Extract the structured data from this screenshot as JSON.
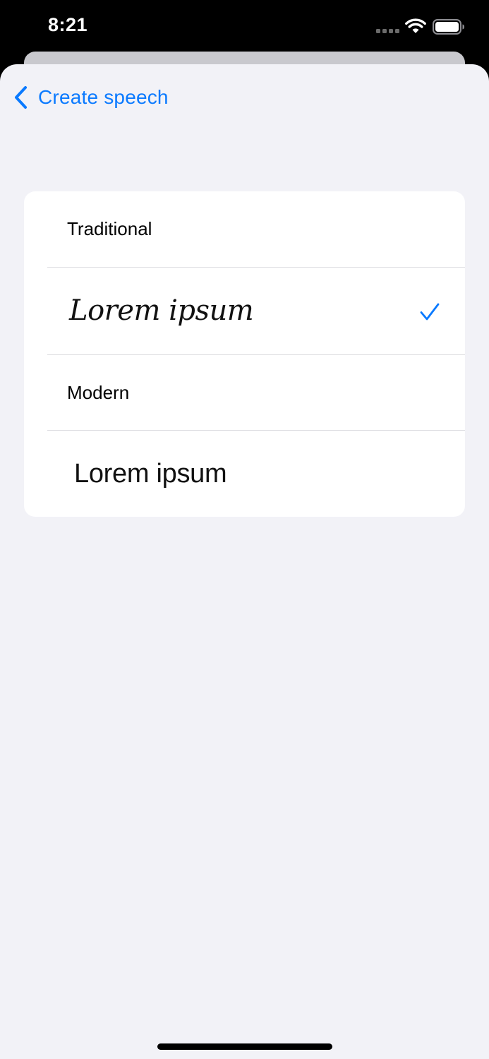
{
  "status_bar": {
    "time": "8:21"
  },
  "nav": {
    "back_label": "Create speech"
  },
  "style_options": [
    {
      "label": "Traditional",
      "sample": "Lorem ipsum",
      "selected": true
    },
    {
      "label": "Modern",
      "sample": "Lorem ipsum",
      "selected": false
    }
  ],
  "colors": {
    "accent": "#0a7aff",
    "background": "#f2f2f7",
    "card": "#ffffff"
  },
  "icons": {
    "back": "chevron-left-icon",
    "selected": "checkmark-icon",
    "signal": "cellular-signal-icon",
    "wifi": "wifi-icon",
    "battery": "battery-icon"
  }
}
